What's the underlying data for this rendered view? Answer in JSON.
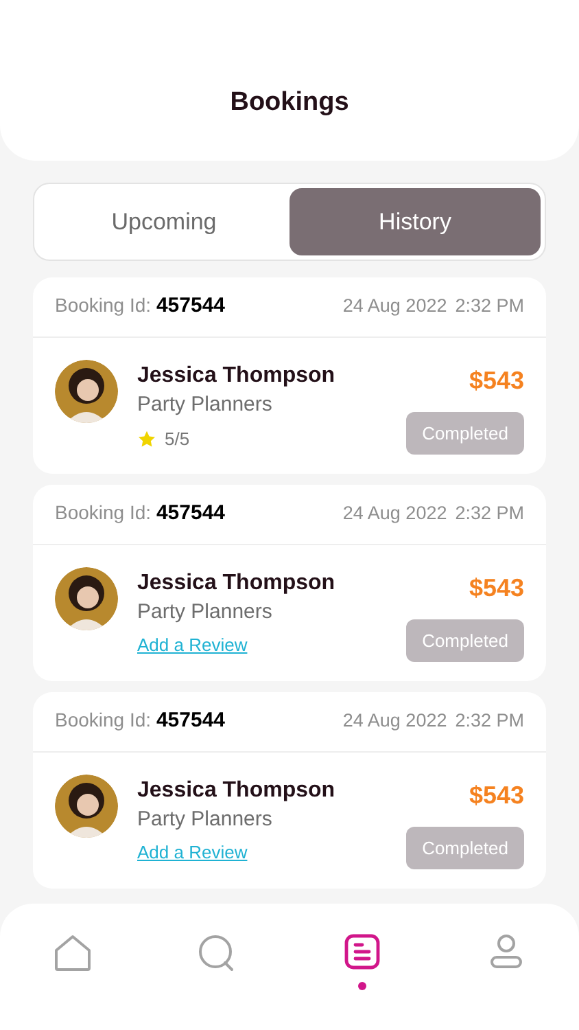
{
  "header": {
    "title": "Bookings"
  },
  "tabs": [
    {
      "label": "Upcoming",
      "selected": false
    },
    {
      "label": "History",
      "selected": true
    }
  ],
  "bookings": [
    {
      "id_label": "Booking Id:",
      "id": "457544",
      "date": "24 Aug 2022",
      "time": "2:32 PM",
      "name": "Jessica Thompson",
      "service": "Party Planners",
      "price": "$543",
      "status": "Completed",
      "kind": "rating",
      "rating": "5/5"
    },
    {
      "id_label": "Booking Id:",
      "id": "457544",
      "date": "24 Aug 2022",
      "time": "2:32 PM",
      "name": "Jessica Thompson",
      "service": "Party Planners",
      "price": "$543",
      "status": "Completed",
      "kind": "review",
      "link": "Add a Review"
    },
    {
      "id_label": "Booking Id:",
      "id": "457544",
      "date": "24 Aug 2022",
      "time": "2:32 PM",
      "name": "Jessica Thompson",
      "service": "Party Planners",
      "price": "$543",
      "status": "Completed",
      "kind": "review",
      "link": "Add a Review"
    }
  ],
  "nav": [
    {
      "kind": "home",
      "selected": false
    },
    {
      "kind": "search",
      "selected": false
    },
    {
      "kind": "bookings",
      "selected": true
    },
    {
      "kind": "profile",
      "selected": false
    }
  ]
}
